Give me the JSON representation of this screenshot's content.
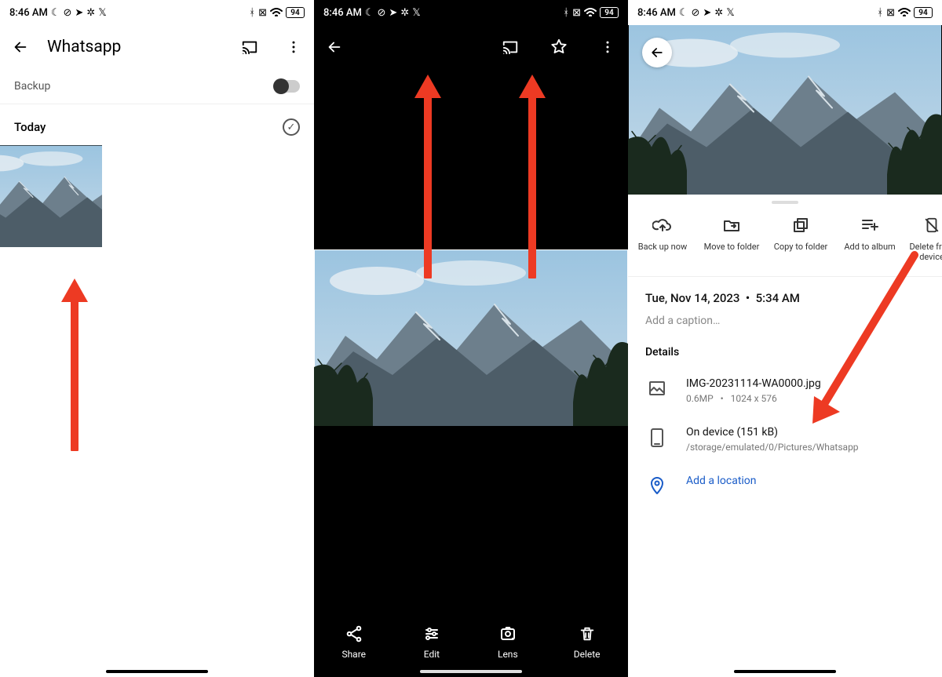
{
  "status": {
    "time": "8:46 AM",
    "battery": "94",
    "icons_left": [
      "moon",
      "dnd",
      "telegram",
      "fan",
      "x"
    ],
    "icons_right": [
      "bluetooth",
      "no-data",
      "wifi"
    ]
  },
  "panel1": {
    "title": "Whatsapp",
    "backup_label": "Backup",
    "today_label": "Today"
  },
  "panel2": {
    "actions": {
      "share": "Share",
      "edit": "Edit",
      "lens": "Lens",
      "delete": "Delete"
    }
  },
  "panel3": {
    "actions": {
      "backup": "Back up now",
      "move": "Move to folder",
      "copy": "Copy to folder",
      "album": "Add to album",
      "delete": "Delete from device"
    },
    "date": "Tue, Nov 14, 2023",
    "time": "5:34 AM",
    "caption_placeholder": "Add a caption…",
    "details_title": "Details",
    "file": {
      "name": "IMG-20231114-WA0000.jpg",
      "mp": "0.6MP",
      "dims": "1024 x 576"
    },
    "storage": {
      "line1": "On device (151 kB)",
      "path": "/storage/emulated/0/Pictures/Whatsapp"
    },
    "location_label": "Add a location"
  },
  "colors": {
    "arrow": "#ed3a23",
    "link": "#1a5cc8"
  }
}
